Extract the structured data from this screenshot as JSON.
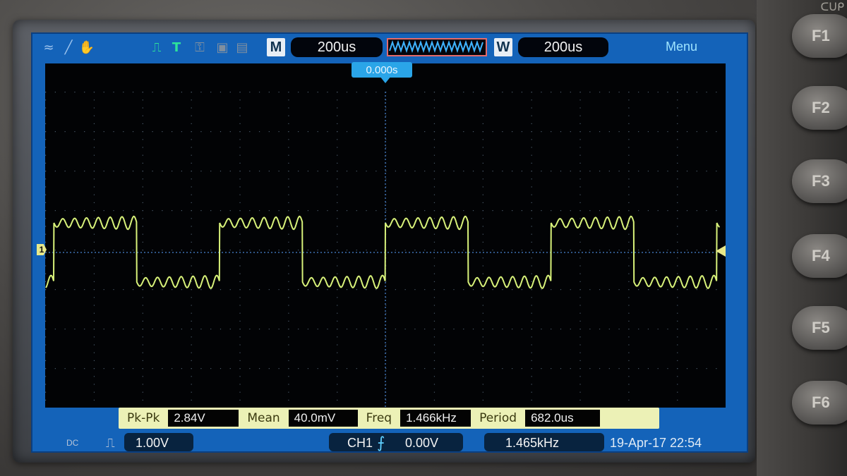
{
  "header": {
    "timebase_badge": "M",
    "timebase": "200us",
    "window_badge": "W",
    "window": "200us",
    "menu": "Menu",
    "trigger_time": "0.000s"
  },
  "measurements": {
    "pkpk_label": "Pk-Pk",
    "pkpk_value": "2.84V",
    "mean_label": "Mean",
    "mean_value": "40.0mV",
    "freq_label": "Freq",
    "freq_value": "1.466kHz",
    "period_label": "Period",
    "period_value": "682.0us"
  },
  "status": {
    "coupling": "DC",
    "ch_scale": "1.00V",
    "trigger_source": "CH1",
    "trigger_level": "0.00V",
    "counter": "1.465kHz",
    "datetime": "19-Apr-17 22:54"
  },
  "markers": {
    "channel": "1"
  },
  "softkeys": [
    "F1",
    "F2",
    "F3",
    "F4",
    "F5",
    "F6"
  ],
  "colors": {
    "trace": "#d8f27a",
    "lcd_blue": "#1463b9",
    "accent_cyan": "#5fd0ff"
  },
  "chart_data": {
    "type": "line",
    "title": "",
    "xlabel": "",
    "ylabel": "",
    "series": [
      {
        "waveform": "square-with-ringing",
        "x_unit": "us",
        "y_unit": "V",
        "high_level": 1.42,
        "low_level": -1.42,
        "period_us": 682.0,
        "freq_khz": 1.466,
        "duty": 0.5,
        "ringing_amplitude": 0.18,
        "ringing_cycles_per_half": 7
      }
    ],
    "x_divisions": 14,
    "y_divisions": 8,
    "x_per_div": "200us",
    "y_per_div": "1.00V",
    "grid": true
  }
}
